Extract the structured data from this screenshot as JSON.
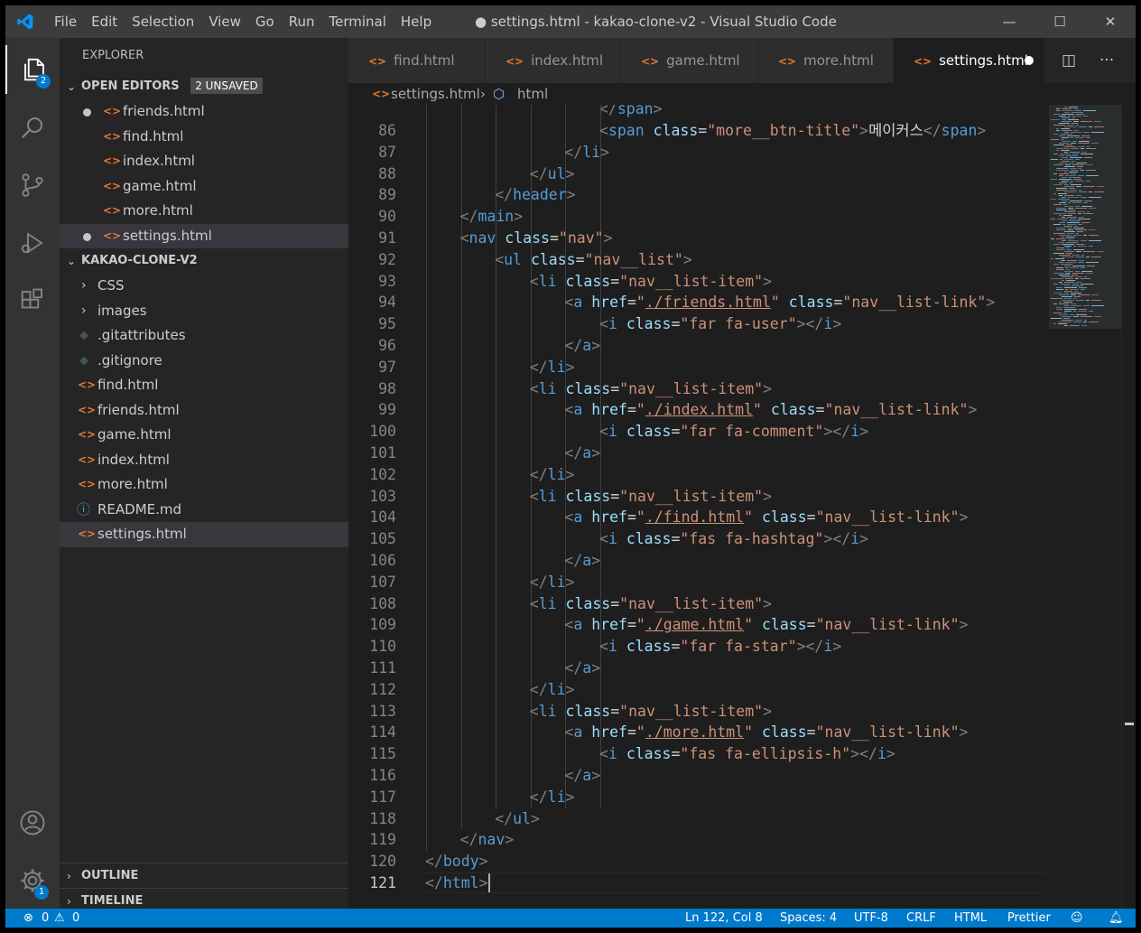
{
  "titlebar": {
    "menu": [
      "File",
      "Edit",
      "Selection",
      "View",
      "Go",
      "Run",
      "Terminal",
      "Help"
    ],
    "title": "● settings.html - kakao-clone-v2 - Visual Studio Code",
    "minimize": "—",
    "maximize": "☐",
    "close": "✕"
  },
  "activity_bar": {
    "explorer_badge": "2",
    "settings_badge": "1"
  },
  "sidebar": {
    "header": "EXPLORER",
    "open_editors": {
      "title": "OPEN EDITORS",
      "badge": "2 UNSAVED",
      "files": [
        {
          "name": "friends.html",
          "dirty": true
        },
        {
          "name": "find.html",
          "dirty": false
        },
        {
          "name": "index.html",
          "dirty": false
        },
        {
          "name": "game.html",
          "dirty": false
        },
        {
          "name": "more.html",
          "dirty": false
        },
        {
          "name": "settings.html",
          "dirty": true
        }
      ]
    },
    "project": {
      "title": "KAKAO-CLONE-V2",
      "folders": [
        "CSS",
        "images"
      ],
      "files": [
        ".gitattributes",
        ".gitignore",
        "find.html",
        "friends.html",
        "game.html",
        "index.html",
        "more.html",
        "README.md",
        "settings.html"
      ]
    },
    "outline": "OUTLINE",
    "timeline": "TIMELINE"
  },
  "tabs": [
    {
      "label": "find.html"
    },
    {
      "label": "index.html"
    },
    {
      "label": "game.html"
    },
    {
      "label": "more.html"
    },
    {
      "label": "settings.html"
    }
  ],
  "breadcrumb": {
    "file": "settings.html",
    "separator": "›",
    "node": "html"
  },
  "editor": {
    "lines": [
      {
        "n": "86",
        "t": "<span class=\"more__btn-title\">메이커스</span>"
      },
      {
        "n": "87",
        "t": "</li>"
      },
      {
        "n": "88",
        "t": "</ul>"
      },
      {
        "n": "89",
        "t": "</header>"
      },
      {
        "n": "90",
        "t": "</main>"
      },
      {
        "n": "91",
        "t": "<nav class=\"nav\">"
      },
      {
        "n": "92",
        "t": "<ul class=\"nav__list\">"
      },
      {
        "n": "93",
        "t": "<li class=\"nav__list-item\">"
      },
      {
        "n": "94",
        "t": "<a href=\"./friends.html\" class=\"nav__list-link\">"
      },
      {
        "n": "95",
        "t": "<i class=\"far fa-user\"></i>"
      },
      {
        "n": "96",
        "t": "</a>"
      },
      {
        "n": "97",
        "t": "</li>"
      },
      {
        "n": "98",
        "t": "<li class=\"nav__list-item\">"
      },
      {
        "n": "99",
        "t": "<a href=\"./index.html\" class=\"nav__list-link\">"
      },
      {
        "n": "100",
        "t": "<i class=\"far fa-comment\"></i>"
      },
      {
        "n": "101",
        "t": "</a>"
      },
      {
        "n": "102",
        "t": "</li>"
      },
      {
        "n": "103",
        "t": "<li class=\"nav__list-item\">"
      },
      {
        "n": "104",
        "t": "<a href=\"./find.html\" class=\"nav__list-link\">"
      },
      {
        "n": "105",
        "t": "<i class=\"fas fa-hashtag\"></i>"
      },
      {
        "n": "106",
        "t": "</a>"
      },
      {
        "n": "107",
        "t": "</li>"
      },
      {
        "n": "108",
        "t": "<li class=\"nav__list-item\">"
      },
      {
        "n": "109",
        "t": "<a href=\"./game.html\" class=\"nav__list-link\">"
      },
      {
        "n": "110",
        "t": "<i class=\"far fa-star\"></i>"
      },
      {
        "n": "111",
        "t": "</a>"
      },
      {
        "n": "112",
        "t": "</li>"
      },
      {
        "n": "113",
        "t": "<li class=\"nav__list-item\">"
      },
      {
        "n": "114",
        "t": "<a href=\"./more.html\" class=\"nav__list-link\">"
      },
      {
        "n": "115",
        "t": "<i class=\"fas fa-ellipsis-h\"></i>"
      },
      {
        "n": "116",
        "t": "</a>"
      },
      {
        "n": "117",
        "t": "</li>"
      },
      {
        "n": "118",
        "t": "</ul>"
      },
      {
        "n": "119",
        "t": "</nav>"
      },
      {
        "n": "120",
        "t": "</body>"
      },
      {
        "n": "121",
        "t": "</html>"
      }
    ]
  },
  "statusbar": {
    "errors": "0",
    "warnings": "0",
    "position": "Ln 122, Col 8",
    "spaces": "Spaces: 4",
    "encoding": "UTF-8",
    "eol": "CRLF",
    "language": "HTML",
    "formatter": "Prettier"
  },
  "colors": {
    "accent": "#007acc",
    "file_icon": "#e37933",
    "tag": "#569cd6",
    "attr": "#9cdcfe",
    "string": "#ce9178"
  }
}
